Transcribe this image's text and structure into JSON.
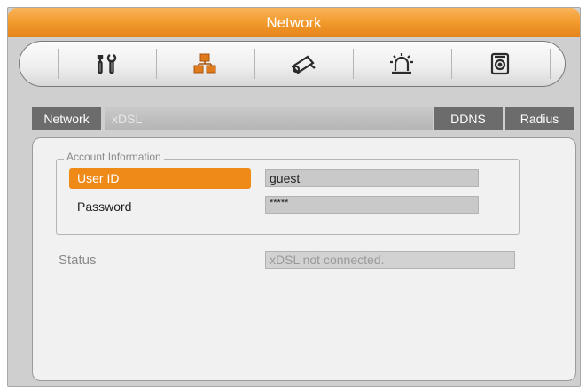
{
  "window": {
    "title": "Network"
  },
  "toolbar": {
    "icons": [
      {
        "name": "tools-icon",
        "color": "#2b2b2b"
      },
      {
        "name": "network-icon",
        "color": "#e07b1c"
      },
      {
        "name": "camera-icon",
        "color": "#2b2b2b"
      },
      {
        "name": "alarm-icon",
        "color": "#2b2b2b"
      },
      {
        "name": "storage-icon",
        "color": "#2b2b2b"
      }
    ]
  },
  "tabs": {
    "network": "Network",
    "xdsl": "xDSL",
    "ddns": "DDNS",
    "radius": "Radius"
  },
  "account": {
    "legend": "Account Information",
    "user_id_label": "User ID",
    "user_id_value": "guest",
    "password_label": "Password",
    "password_value": "*****"
  },
  "status": {
    "label": "Status",
    "value": "xDSL not connected."
  },
  "colors": {
    "accent": "#ef8a18",
    "titlebar": "#f39c2f"
  }
}
